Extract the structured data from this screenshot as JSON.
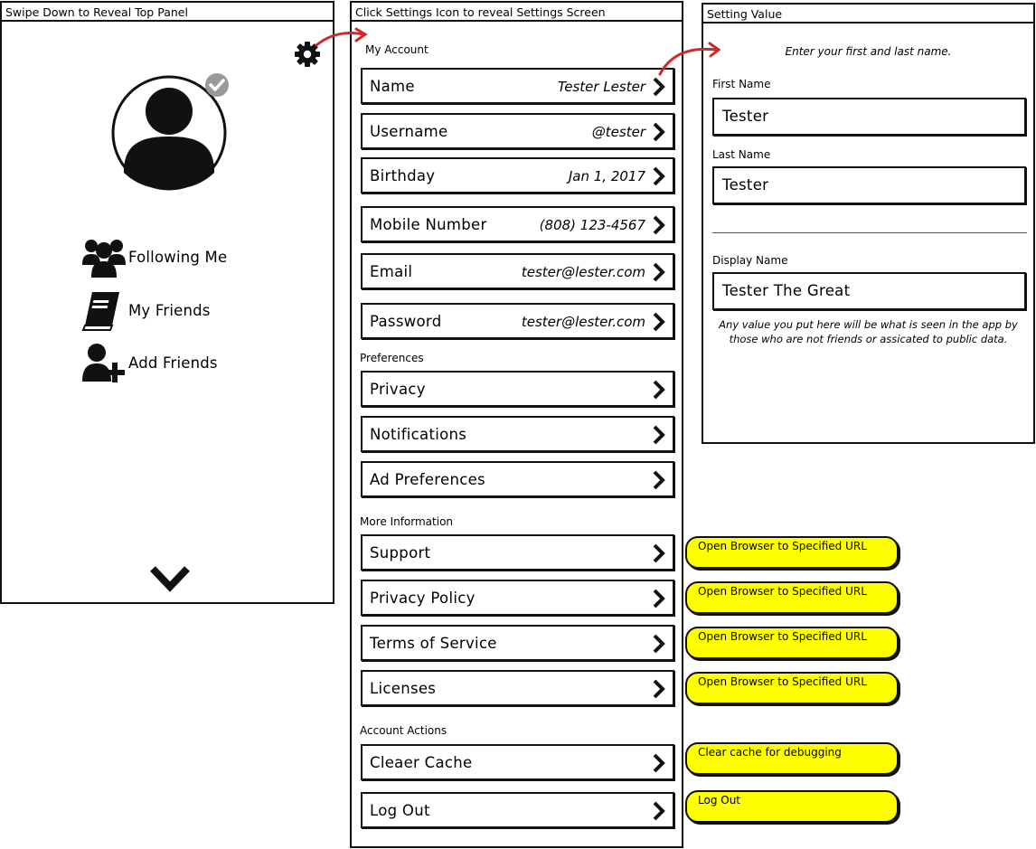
{
  "left_panel": {
    "title": "Swipe Down to Reveal Top Panel",
    "menu": [
      {
        "label": "Following Me",
        "icon": "group-icon"
      },
      {
        "label": "My Friends",
        "icon": "book-icon"
      },
      {
        "label": "Add Friends",
        "icon": "add-user-icon"
      }
    ]
  },
  "settings_panel": {
    "title": "Click Settings Icon to reveal Settings Screen",
    "sections": [
      {
        "heading": "My Account",
        "rows": [
          {
            "label": "Name",
            "value": "Tester Lester"
          },
          {
            "label": "Username",
            "value": "@tester"
          },
          {
            "label": "Birthday",
            "value": "Jan 1, 2017"
          },
          {
            "label": "Mobile Number",
            "value": "(808) 123-4567"
          },
          {
            "label": "Email",
            "value": "tester@lester.com"
          },
          {
            "label": "Password",
            "value": "tester@lester.com"
          }
        ]
      },
      {
        "heading": "Preferences",
        "rows": [
          {
            "label": "Privacy"
          },
          {
            "label": "Notifications"
          },
          {
            "label": "Ad Preferences"
          }
        ]
      },
      {
        "heading": "More Information",
        "rows": [
          {
            "label": "Support"
          },
          {
            "label": "Privacy Policy"
          },
          {
            "label": "Terms of Service"
          },
          {
            "label": "Licenses"
          }
        ]
      },
      {
        "heading": "Account Actions",
        "rows": [
          {
            "label": "Cleaer Cache"
          },
          {
            "label": "Log Out"
          }
        ]
      }
    ]
  },
  "setting_value_panel": {
    "title": "Setting Value",
    "hint": "Enter your first and last name.",
    "first_name_label": "First Name",
    "first_name_value": "Tester",
    "last_name_label": "Last Name",
    "last_name_value": "Tester",
    "display_name_label": "Display Name",
    "display_name_value": "Tester The Great",
    "display_name_note": "Any value you put here will be what is seen in the app by those who are not friends or assicated to public data."
  },
  "annotations": [
    "Open Browser to Specified URL",
    "Open Browser to Specified URL",
    "Open Browser to Specified URL",
    "Open Browser to Specified URL",
    "Clear cache for debugging",
    "Log Out"
  ],
  "colors": {
    "arrow": "#cc2b2b",
    "sticky": "#ffff00",
    "badge": "#9a9a9a"
  }
}
